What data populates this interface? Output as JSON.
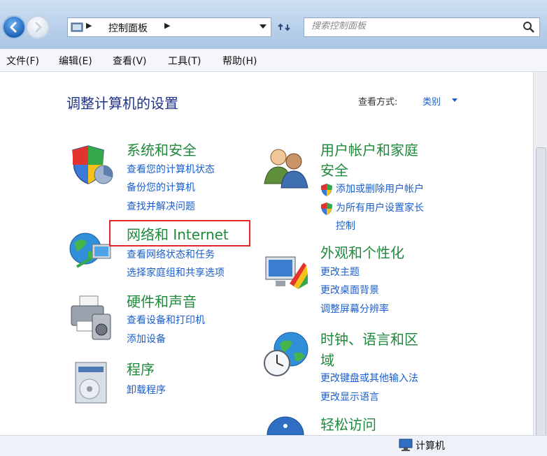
{
  "address_bar": {
    "breadcrumb": "控制面板",
    "search_placeholder": "搜索控制面板"
  },
  "menu": [
    "文件(F)",
    "编辑(E)",
    "查看(V)",
    "工具(T)",
    "帮助(H)"
  ],
  "main": {
    "title": "调整计算机的设置",
    "view_by_label": "查看方式:",
    "view_by_value": "类别"
  },
  "categories": [
    {
      "id": "system-security",
      "title": "系统和安全",
      "links": [
        "查看您的计算机状态",
        "备份您的计算机",
        "查找并解决问题"
      ]
    },
    {
      "id": "network-internet",
      "title": "网络和 Internet",
      "links": [
        "查看网络状态和任务",
        "选择家庭组和共享选项"
      ]
    },
    {
      "id": "hardware-sound",
      "title": "硬件和声音",
      "links": [
        "查看设备和打印机",
        "添加设备"
      ]
    },
    {
      "id": "programs",
      "title": "程序",
      "links": [
        "卸载程序"
      ]
    },
    {
      "id": "user-accounts",
      "title_line1": "用户帐户和家庭",
      "title_line2": "安全",
      "links": [
        "添加或删除用户帐户",
        "为所有用户设置家长",
        "控制"
      ]
    },
    {
      "id": "appearance",
      "title": "外观和个性化",
      "links": [
        "更改主题",
        "更改桌面背景",
        "调整屏幕分辨率"
      ]
    },
    {
      "id": "clock-language",
      "title_line1": "时钟、语言和区",
      "title_line2": "域",
      "links": [
        "更改键盘或其他输入法",
        "更改显示语言"
      ]
    },
    {
      "id": "ease-of-access",
      "title": "轻松访问"
    }
  ],
  "status": {
    "text": "计算机"
  },
  "colors": {
    "category_title": "#1f8a3c",
    "link": "#1b5fcc",
    "highlight": "#e3262b"
  }
}
